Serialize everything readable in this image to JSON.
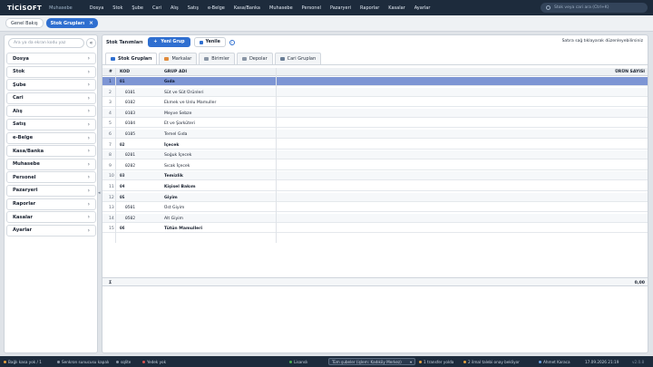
{
  "app": {
    "logo": "TİCİSOFT",
    "module": "Muhasebe"
  },
  "menu": [
    "Dosya",
    "Stok",
    "Şube",
    "Cari",
    "Alış",
    "Satış",
    "e-Belge",
    "Kasa/Banka",
    "Muhasebe",
    "Personel",
    "Pazaryeri",
    "Raporlar",
    "Kasalar",
    "Ayarlar"
  ],
  "search": {
    "placeholder": "Stok veya cari ara (Ctrl+K)"
  },
  "tabs": [
    {
      "label": "Genel Bakış"
    },
    {
      "label": "Stok Grupları"
    }
  ],
  "sidebar": {
    "search_placeholder": "Ara ya da ekran kodu yaz",
    "collapse": "«",
    "items": [
      "Dosya",
      "Stok",
      "Şube",
      "Cari",
      "Alış",
      "Satış",
      "e-Belge",
      "Kasa/Banka",
      "Muhasebe",
      "Personel",
      "Pazaryeri",
      "Raporlar",
      "Kasalar",
      "Ayarlar"
    ]
  },
  "main": {
    "title": "Stok Tanımları",
    "new_button": "Yeni Grup",
    "refresh_button": "Yenile",
    "info": "i",
    "hint": "Satıra sağ tıklayarak düzenleyebilirsiniz",
    "subtabs": [
      "Stok Grupları",
      "Markalar",
      "Birimler",
      "Depolar",
      "Cari Grupları"
    ],
    "columns": {
      "idx": "#",
      "code": "KOD",
      "name": "GRUP ADI",
      "count": "ÜRÜN SAYISI"
    },
    "rows": [
      {
        "n": "1",
        "code": "01",
        "name": "Gıda",
        "level": 0
      },
      {
        "n": "2",
        "code": "0101",
        "name": "Süt ve Süt Ürünleri",
        "level": 1
      },
      {
        "n": "3",
        "code": "0102",
        "name": "Ekmek ve Unlu Mamuller",
        "level": 1
      },
      {
        "n": "4",
        "code": "0103",
        "name": "Meyve Sebze",
        "level": 1
      },
      {
        "n": "5",
        "code": "0104",
        "name": "Et ve Şarküteri",
        "level": 1
      },
      {
        "n": "6",
        "code": "0105",
        "name": "Temel Gıda",
        "level": 1
      },
      {
        "n": "7",
        "code": "02",
        "name": "İçecek",
        "level": 0
      },
      {
        "n": "8",
        "code": "0201",
        "name": "Soğuk İçecek",
        "level": 1
      },
      {
        "n": "9",
        "code": "0202",
        "name": "Sıcak İçecek",
        "level": 1
      },
      {
        "n": "10",
        "code": "03",
        "name": "Temizlik",
        "level": 0
      },
      {
        "n": "11",
        "code": "04",
        "name": "Kişisel Bakım",
        "level": 0
      },
      {
        "n": "12",
        "code": "05",
        "name": "Giyim",
        "level": 0
      },
      {
        "n": "13",
        "code": "0501",
        "name": "Üst Giyim",
        "level": 1
      },
      {
        "n": "14",
        "code": "0502",
        "name": "Alt Giyim",
        "level": 1
      },
      {
        "n": "15",
        "code": "06",
        "name": "Tütün Mamulleri",
        "level": 0
      }
    ],
    "footer": {
      "sigma": "Σ",
      "total": "0,00"
    }
  },
  "status": {
    "cash": "Bağlı kasa yok / 1",
    "server": "Senkron sunucusu kapalı",
    "db": "sqlite",
    "backup": "Yedek yok",
    "license": "Lisanslı",
    "branch": "Tüm şubeler (işlem: Kadıköy Merkez)",
    "transfer": "1 transfer yolda",
    "approvals": "2 ilmal talebi onay bekliyor",
    "user": "Ahmet Karaca",
    "datetime": "17.09.2026 21:19",
    "version": "v2.0.8"
  },
  "colors": {
    "accent": "#2f6fd0",
    "selected_row": "#7d95d4",
    "topbar": "#1d2b3c"
  }
}
